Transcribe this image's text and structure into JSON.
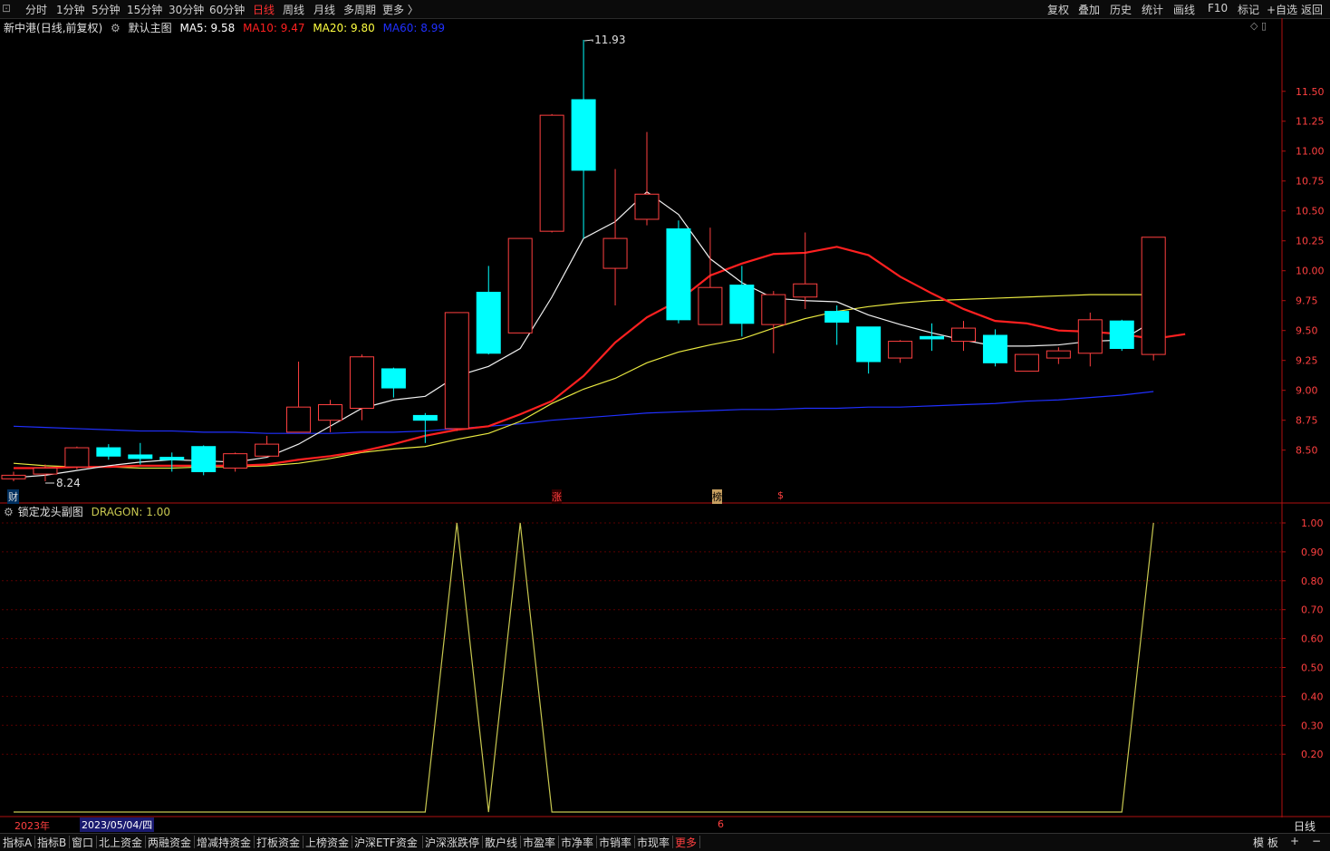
{
  "toolbar": {
    "periods": [
      "分时",
      "1分钟",
      "5分钟",
      "15分钟",
      "30分钟",
      "60分钟",
      "日线",
      "周线",
      "月线",
      "多周期",
      "更多 〉"
    ],
    "active_period": "日线",
    "right_buttons": [
      "复权",
      "叠加",
      "历史",
      "统计",
      "画线",
      "F10",
      "标记",
      "+自选",
      "返回"
    ]
  },
  "main_chart": {
    "stock": "新中港",
    "mode": "(日线,前复权)",
    "template": "默认主图",
    "ma": [
      {
        "label": "MA5: 9.58",
        "color": "#ffffff"
      },
      {
        "label": "MA10: 9.47",
        "color": "#ff2020"
      },
      {
        "label": "MA20: 9.80",
        "color": "#ffff40"
      },
      {
        "label": "MA60: 8.99",
        "color": "#2030ff"
      }
    ],
    "high_label": "11.93",
    "low_label": "8.24",
    "markers": {
      "cai": "财",
      "zhang": "涨",
      "bang": "榜",
      "dollar": "$"
    }
  },
  "chart_data": {
    "type": "candlestick",
    "ylim": [
      8.05,
      12.05
    ],
    "yticks": [
      "11.50",
      "11.25",
      "11.00",
      "10.75",
      "10.50",
      "10.25",
      "10.00",
      "9.75",
      "9.50",
      "9.25",
      "9.00",
      "8.75",
      "8.50"
    ],
    "candles": [
      {
        "o": 8.26,
        "c": 8.29,
        "h": 8.32,
        "l": 8.24
      },
      {
        "o": 8.3,
        "c": 8.35,
        "h": 8.38,
        "l": 8.24
      },
      {
        "o": 8.36,
        "c": 8.52,
        "h": 8.53,
        "l": 8.34
      },
      {
        "o": 8.52,
        "c": 8.45,
        "h": 8.55,
        "l": 8.42
      },
      {
        "o": 8.46,
        "c": 8.43,
        "h": 8.56,
        "l": 8.38
      },
      {
        "o": 8.44,
        "c": 8.42,
        "h": 8.48,
        "l": 8.32
      },
      {
        "o": 8.53,
        "c": 8.32,
        "h": 8.54,
        "l": 8.29
      },
      {
        "o": 8.35,
        "c": 8.47,
        "h": 8.48,
        "l": 8.32
      },
      {
        "o": 8.45,
        "c": 8.55,
        "h": 8.62,
        "l": 8.45
      },
      {
        "o": 8.65,
        "c": 8.86,
        "h": 9.24,
        "l": 8.65
      },
      {
        "o": 8.75,
        "c": 8.88,
        "h": 8.92,
        "l": 8.65
      },
      {
        "o": 8.85,
        "c": 9.28,
        "h": 9.3,
        "l": 8.75
      },
      {
        "o": 9.18,
        "c": 9.02,
        "h": 9.19,
        "l": 8.94
      },
      {
        "o": 8.79,
        "c": 8.75,
        "h": 8.81,
        "l": 8.56
      },
      {
        "o": 8.68,
        "c": 9.65,
        "h": 9.65,
        "l": 8.66
      },
      {
        "o": 9.82,
        "c": 9.31,
        "h": 10.04,
        "l": 9.3
      },
      {
        "o": 9.48,
        "c": 10.27,
        "h": 10.27,
        "l": 9.48
      },
      {
        "o": 10.33,
        "c": 11.3,
        "h": 11.31,
        "l": 10.32
      },
      {
        "o": 11.43,
        "c": 10.84,
        "h": 11.93,
        "l": 10.27
      },
      {
        "o": 10.02,
        "c": 10.27,
        "h": 10.85,
        "l": 9.71
      },
      {
        "o": 10.43,
        "c": 10.64,
        "h": 11.16,
        "l": 10.38
      },
      {
        "o": 10.35,
        "c": 9.59,
        "h": 10.42,
        "l": 9.56
      },
      {
        "o": 9.55,
        "c": 9.86,
        "h": 10.36,
        "l": 9.55
      },
      {
        "o": 9.88,
        "c": 9.56,
        "h": 10.04,
        "l": 9.45
      },
      {
        "o": 9.55,
        "c": 9.8,
        "h": 9.83,
        "l": 9.31
      },
      {
        "o": 9.78,
        "c": 9.89,
        "h": 10.32,
        "l": 9.68
      },
      {
        "o": 9.66,
        "c": 9.57,
        "h": 9.71,
        "l": 9.38
      },
      {
        "o": 9.53,
        "c": 9.24,
        "h": 9.53,
        "l": 9.14
      },
      {
        "o": 9.27,
        "c": 9.41,
        "h": 9.42,
        "l": 9.23
      },
      {
        "o": 9.45,
        "c": 9.43,
        "h": 9.56,
        "l": 9.33
      },
      {
        "o": 9.41,
        "c": 9.52,
        "h": 9.58,
        "l": 9.33
      },
      {
        "o": 9.46,
        "c": 9.23,
        "h": 9.51,
        "l": 9.2
      },
      {
        "o": 9.16,
        "c": 9.3,
        "h": 9.3,
        "l": 9.16
      },
      {
        "o": 9.27,
        "c": 9.33,
        "h": 9.36,
        "l": 9.22
      },
      {
        "o": 9.31,
        "c": 9.59,
        "h": 9.65,
        "l": 9.2
      },
      {
        "o": 9.58,
        "c": 9.35,
        "h": 9.59,
        "l": 9.33
      },
      {
        "o": 9.3,
        "c": 10.28,
        "h": 10.28,
        "l": 9.25
      }
    ],
    "ma5": [
      8.27,
      8.29,
      8.33,
      8.37,
      8.4,
      8.42,
      8.41,
      8.4,
      8.44,
      8.55,
      8.7,
      8.85,
      8.92,
      8.95,
      9.12,
      9.2,
      9.35,
      9.78,
      10.27,
      10.41,
      10.66,
      10.47,
      10.1,
      9.9,
      9.77,
      9.75,
      9.74,
      9.63,
      9.55,
      9.48,
      9.42,
      9.37,
      9.37,
      9.38,
      9.41,
      9.42,
      9.58
    ],
    "ma10": [
      8.35,
      8.35,
      8.36,
      8.36,
      8.37,
      8.37,
      8.37,
      8.37,
      8.38,
      8.42,
      8.45,
      8.49,
      8.55,
      8.62,
      8.67,
      8.7,
      8.8,
      8.91,
      9.12,
      9.4,
      9.61,
      9.75,
      9.96,
      10.06,
      10.14,
      10.15,
      10.2,
      10.13,
      9.95,
      9.81,
      9.68,
      9.58,
      9.56,
      9.5,
      9.49,
      9.47,
      9.43,
      9.47
    ],
    "ma20": [
      8.39,
      8.37,
      8.36,
      8.36,
      8.35,
      8.35,
      8.36,
      8.36,
      8.37,
      8.39,
      8.43,
      8.48,
      8.51,
      8.53,
      8.59,
      8.64,
      8.74,
      8.89,
      9.01,
      9.1,
      9.23,
      9.32,
      9.38,
      9.43,
      9.52,
      9.6,
      9.66,
      9.7,
      9.73,
      9.75,
      9.76,
      9.77,
      9.78,
      9.79,
      9.8,
      9.8,
      9.8
    ],
    "ma60": [
      8.7,
      8.69,
      8.68,
      8.67,
      8.66,
      8.66,
      8.65,
      8.65,
      8.64,
      8.64,
      8.64,
      8.65,
      8.65,
      8.66,
      8.68,
      8.7,
      8.72,
      8.75,
      8.77,
      8.79,
      8.81,
      8.82,
      8.83,
      8.84,
      8.84,
      8.85,
      8.85,
      8.86,
      8.86,
      8.87,
      8.88,
      8.89,
      8.91,
      8.92,
      8.94,
      8.96,
      8.99
    ]
  },
  "sub_chart": {
    "title": "锁定龙头副图",
    "indicator": "DRAGON: 1.00",
    "ylim": [
      0,
      1.0
    ],
    "yticks": [
      "1.00",
      "0.90",
      "0.80",
      "0.70",
      "0.60",
      "0.50",
      "0.40",
      "0.30",
      "0.20"
    ],
    "dragon": [
      0,
      0,
      0,
      0,
      0,
      0,
      0,
      0,
      0,
      0,
      0,
      0,
      0,
      0,
      1,
      0,
      1,
      0,
      0,
      0,
      0,
      0,
      0,
      0,
      0,
      0,
      0,
      0,
      0,
      0,
      0,
      0,
      0,
      0,
      0,
      0,
      1
    ]
  },
  "date_bar": {
    "year": "2023年",
    "date": "2023/05/04/四",
    "tick": "6",
    "period": "日线"
  },
  "bottom_tabs": [
    "指标A",
    "指标B",
    "窗口",
    "北上资金",
    "两融资金",
    "增减持资金",
    "打板资金",
    "上榜资金",
    "沪深ETF资金",
    "沪深涨跌停",
    "散户线",
    "市盈率",
    "市净率",
    "市销率",
    "市现率",
    "更多"
  ],
  "bottom_right": [
    "模 板",
    "+",
    "−"
  ],
  "colors": {
    "up": "#ff4040",
    "down": "#00ffff",
    "axis": "#b01010",
    "grid": "#5a0000",
    "dragon": "#c8c850"
  }
}
